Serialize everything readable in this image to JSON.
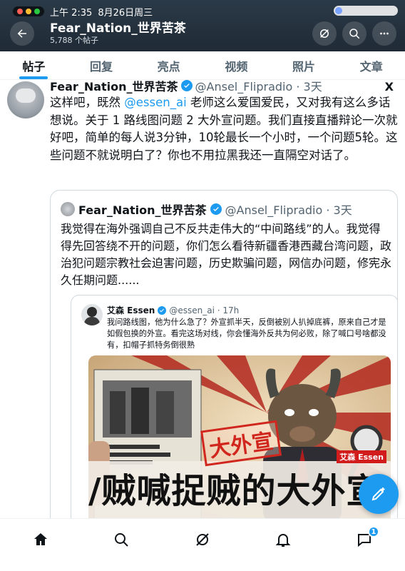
{
  "status_bar": {
    "time": "上午 2:35",
    "date": "8月26日周三"
  },
  "header": {
    "title": "Fear_Nation_世界苦茶",
    "subtitle": "5,788 个帖子"
  },
  "tabs": [
    {
      "label": "帖子",
      "active": true
    },
    {
      "label": "回复",
      "active": false
    },
    {
      "label": "亮点",
      "active": false
    },
    {
      "label": "视频",
      "active": false
    },
    {
      "label": "照片",
      "active": false
    },
    {
      "label": "文章",
      "active": false
    }
  ],
  "post": {
    "author_name": "Fear_Nation_世界苦茶",
    "handle": "@Ansel_Flipradio · 3天",
    "text_pre": "这样吧，既然 ",
    "mention": "@essen_ai",
    "text_post": " 老师这么爱国爱民，又对我有这么多话想说。关于 1 路线图问题 2 大外宣问题。我们直接直播辩论一次就好吧，简单的每人说3分钟，10轮最长一个小时，一个问题5轮。这些问题不就说明白了？你也不用拉黑我还一直隔空对话了。",
    "x_logo": "X"
  },
  "quote": {
    "author_name": "Fear_Nation_世界苦茶",
    "handle": "@Ansel_Flipradio · 3天",
    "text": "我觉得在海外强调自己不反共走伟大的“中间路线”的人。我觉得得先回答绕不开的问题，你们怎么看待新疆香港西藏台湾问题，政治犯问题宗教社会迫害问题，历史欺骗问题，网信办问题，修宪永久任期问题......"
  },
  "nested": {
    "author_name": "艾森 Essen",
    "handle": "@essen_ai · 17h",
    "text": "我问路线图，他为什么急了？外宣抓半天，反倒被别人扒掉底裤，原来自己才是如假包换的外宣。看完这场对线，你会懂海外反共为何必败，除了喊口号啥都没有，扣帽子抓特务倒很熟"
  },
  "image": {
    "stamp": "大外宣",
    "tag": "艾森 Essen",
    "headline": "/贼喊捉贼的大外宣"
  },
  "bottom_nav": {
    "items": [
      "home-icon",
      "search-icon",
      "grok-icon",
      "notifications-icon",
      "messages-icon"
    ],
    "messages_badge": "1"
  },
  "colors": {
    "accent": "#1d9bf0",
    "header_bg": "#1f2a35"
  }
}
